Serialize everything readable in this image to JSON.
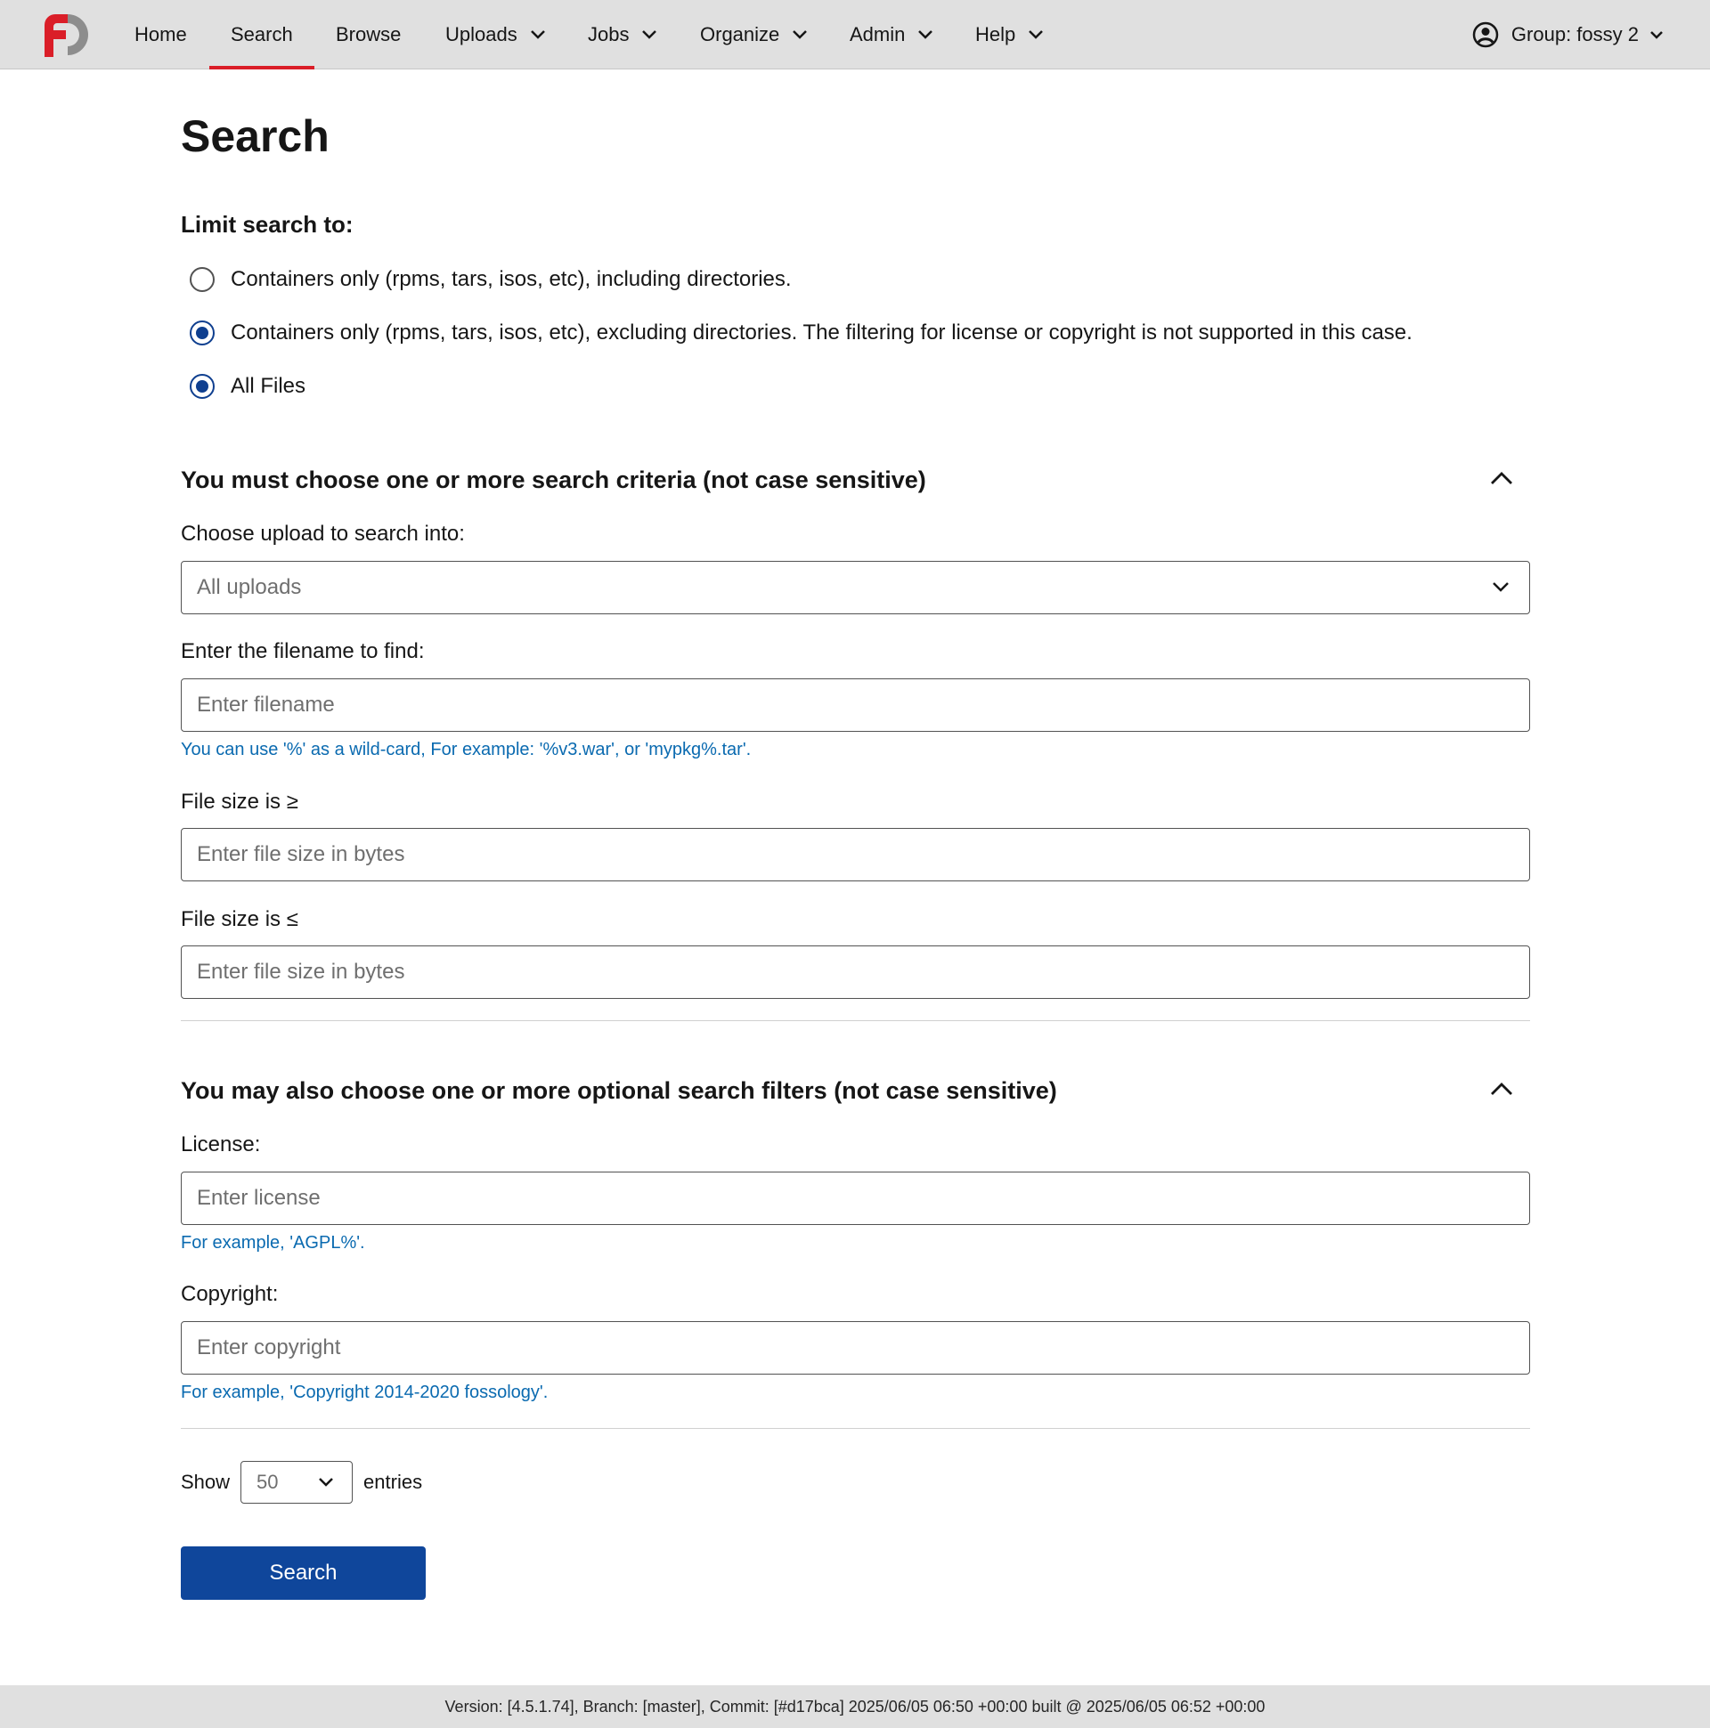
{
  "nav": {
    "items": [
      {
        "label": "Home",
        "has_menu": false
      },
      {
        "label": "Search",
        "has_menu": false,
        "active": true
      },
      {
        "label": "Browse",
        "has_menu": false
      },
      {
        "label": "Uploads",
        "has_menu": true
      },
      {
        "label": "Jobs",
        "has_menu": true
      },
      {
        "label": "Organize",
        "has_menu": true
      },
      {
        "label": "Admin",
        "has_menu": true
      },
      {
        "label": "Help",
        "has_menu": true
      }
    ],
    "group_label": "Group: fossy 2",
    "logo_icon": "fossology-logo",
    "brand_color": "#da1e28"
  },
  "page": {
    "title": "Search",
    "limit_label": "Limit search to:",
    "radio_options": [
      {
        "label": "Containers only (rpms, tars, isos, etc), including directories.",
        "checked": false
      },
      {
        "label": "Containers only (rpms, tars, isos, etc), excluding directories. The filtering for license or copyright is not supported in this case.",
        "checked": true
      },
      {
        "label": "All Files",
        "checked": true
      }
    ]
  },
  "criteria": {
    "heading": "You must choose one or more search criteria (not case sensitive)",
    "upload_label": "Choose upload to search into:",
    "upload_value": "All uploads",
    "filename_label": "Enter the filename to find:",
    "filename_placeholder": "Enter filename",
    "filename_help": "You can use '%' as a wild-card, For example: '%v3.war', or 'mypkg%.tar'.",
    "size_min_label": "File size is ≥",
    "size_min_placeholder": "Enter file size in bytes",
    "size_max_label": "File size is ≤",
    "size_max_placeholder": "Enter file size in bytes"
  },
  "filters": {
    "heading": "You may also choose one or more optional search filters (not case sensitive)",
    "license_label": "License:",
    "license_placeholder": "Enter license",
    "license_help": "For example, 'AGPL%'.",
    "copyright_label": "Copyright:",
    "copyright_placeholder": "Enter copyright",
    "copyright_help": "For example, 'Copyright 2014-2020 fossology'."
  },
  "results": {
    "show_label": "Show",
    "show_value": "50",
    "entries_label": "entries",
    "search_button": "Search"
  },
  "footer": {
    "version_text": "Version: [4.5.1.74], Branch: [master], Commit: [#d17bca] 2025/06/05 06:50 +00:00 built @ 2025/06/05 06:52 +00:00"
  },
  "colors": {
    "accent": "#0f469b",
    "help_text": "#0a6ab0",
    "nav_bg": "#e0e0e0"
  }
}
